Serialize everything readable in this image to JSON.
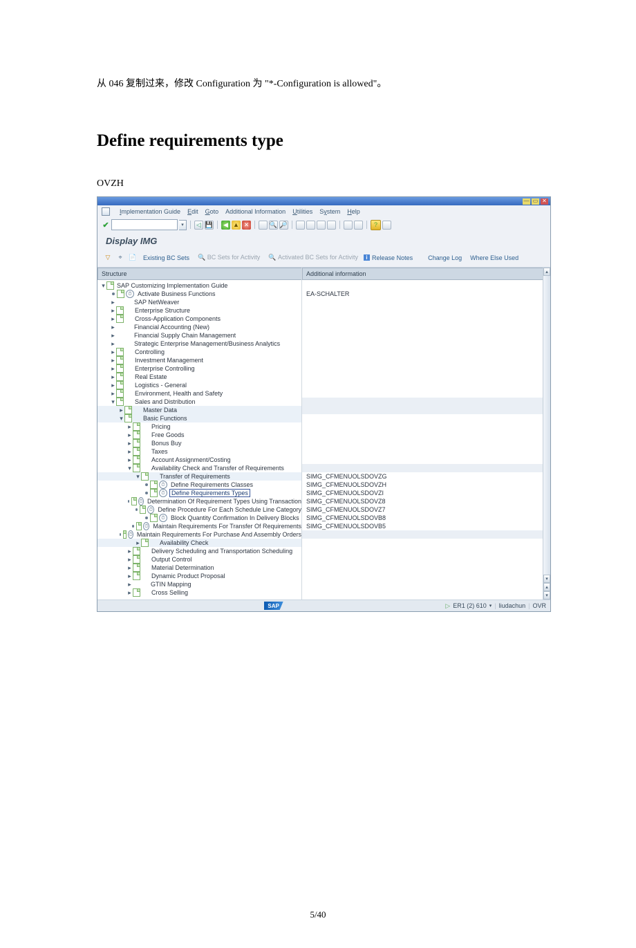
{
  "doc": {
    "intro": "从 046 复制过来，修改 Configuration 为 \"*-Configuration is allowed\"。",
    "heading": "Define requirements type",
    "tcode": "OVZH",
    "page_number": "5/40"
  },
  "sap": {
    "menu": {
      "m1": "Implementation Guide",
      "m2": "Edit",
      "m3": "Goto",
      "m4": "Additional Information",
      "m5": "Utilities",
      "m6": "System",
      "m7": "Help"
    },
    "title": "Display IMG",
    "app_toolbar": {
      "existing_bc": "Existing BC Sets",
      "bc_activity": "BC Sets for Activity",
      "activated_bc": "Activated BC Sets for Activity",
      "release_notes": "Release Notes",
      "change_log": "Change Log",
      "where_else": "Where Else Used"
    },
    "headers": {
      "structure": "Structure",
      "addl_info": "Additional information"
    },
    "tree": {
      "root": "SAP Customizing Implementation Guide",
      "n1": "Activate Business Functions",
      "n2": "SAP NetWeaver",
      "n3": "Enterprise Structure",
      "n4": "Cross-Application Components",
      "n5": "Financial Accounting (New)",
      "n6": "Financial Supply Chain Management",
      "n7": "Strategic Enterprise Management/Business Analytics",
      "n8": "Controlling",
      "n9": "Investment Management",
      "n10": "Enterprise Controlling",
      "n11": "Real Estate",
      "n12": "Logistics - General",
      "n13": "Environment, Health and Safety",
      "n14": "Sales and Distribution",
      "n15": "Master Data",
      "n16": "Basic Functions",
      "n17": "Pricing",
      "n18": "Free Goods",
      "n19": "Bonus Buy",
      "n20": "Taxes",
      "n21": "Account Assignment/Costing",
      "n22": "Availability Check and Transfer of Requirements",
      "n23": "Transfer of Requirements",
      "n24": "Define Requirements Classes",
      "n25": "Define Requirements Types",
      "n26": "Determination Of Requirement Types Using Transaction",
      "n27": "Define Procedure For Each Schedule Line Category",
      "n28": "Block Quantity Confirmation In Delivery Blocks",
      "n29": "Maintain Requirements For Transfer Of Requirements",
      "n30": "Maintain Requirements For Purchase And Assembly Orders",
      "n31": "Availability Check",
      "n32": "Delivery Scheduling and Transportation Scheduling",
      "n33": "Output Control",
      "n34": "Material Determination",
      "n35": "Dynamic Product Proposal",
      "n36": "GTIN Mapping",
      "n37": "Cross Selling"
    },
    "info": {
      "v0": "EA-SCHALTER",
      "v24": "SIMG_CFMENUOLSDOVZG",
      "v25": "SIMG_CFMENUOLSDOVZH",
      "v26": "SIMG_CFMENUOLSDOVZI",
      "v27": "SIMG_CFMENUOLSDOVZ8",
      "v28": "SIMG_CFMENUOLSDOVZ7",
      "v29": "SIMG_CFMENUOLSDOVB8",
      "v30": "SIMG_CFMENUOLSDOVB5"
    },
    "status": {
      "system": "ER1 (2) 610",
      "user": "liudachun",
      "ovr": "OVR"
    }
  }
}
